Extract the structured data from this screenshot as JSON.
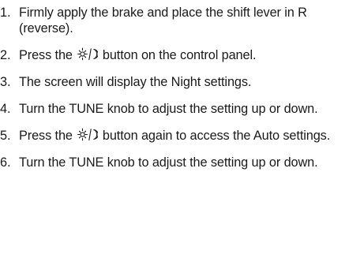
{
  "steps": [
    {
      "number": "1.",
      "text": "Firmly apply the brake and place the shift lever in R (reverse)."
    },
    {
      "number": "2.",
      "before": "Press the",
      "icon": "day-night-icon",
      "after": "button on the control panel."
    },
    {
      "number": "3.",
      "text": "The screen will display the Night settings."
    },
    {
      "number": "4.",
      "text": "Turn the TUNE knob to adjust the setting up or down."
    },
    {
      "number": "5.",
      "before": "Press the",
      "icon": "day-night-icon",
      "after": "button again to access the Auto settings."
    },
    {
      "number": "6.",
      "text": "Turn the TUNE knob to adjust the setting up or down."
    }
  ]
}
